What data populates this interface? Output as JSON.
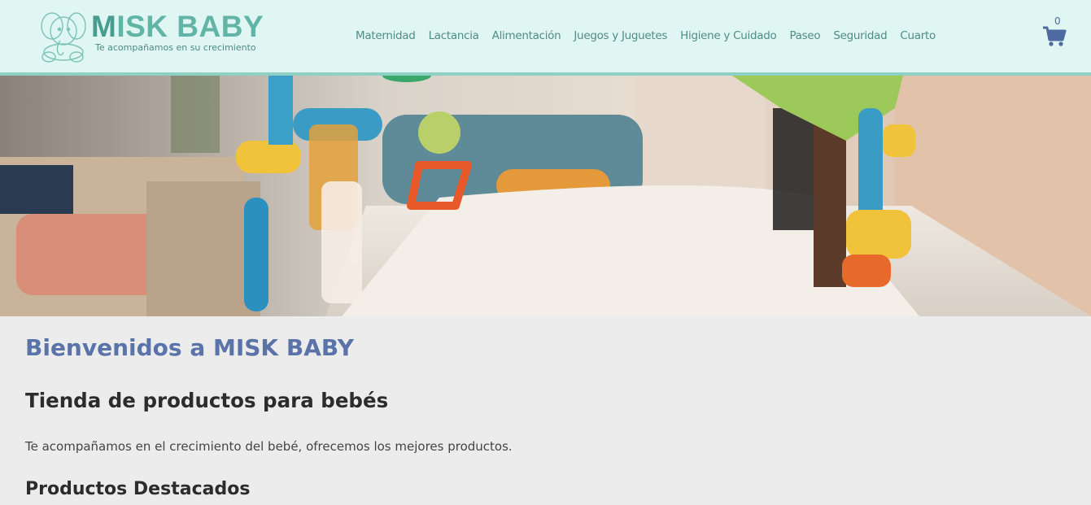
{
  "header": {
    "brand_part1": "M",
    "brand_part2": "ISK B",
    "brand_part3": "ABY",
    "tagline": "Te acompañamos en su crecimiento",
    "logo_icon": "elephant-icon",
    "nav": [
      {
        "label": "Maternidad"
      },
      {
        "label": "Lactancia"
      },
      {
        "label": "Alimentación"
      },
      {
        "label": "Juegos y Juguetes"
      },
      {
        "label": "Higiene y Cuidado"
      },
      {
        "label": "Paseo"
      },
      {
        "label": "Seguridad"
      },
      {
        "label": "Cuarto"
      }
    ],
    "cart": {
      "icon": "cart-icon",
      "count": "0"
    }
  },
  "colors": {
    "header_bg": "#dff6f2",
    "header_border": "#8fd0c4",
    "brand": "#62b5a6",
    "nav_text": "#4f8c85",
    "heading_blue": "#5a73a8",
    "page_bg": "#ececec"
  },
  "main": {
    "welcome": "Bienvenidos a MISK BABY",
    "subtitle": "Tienda de productos para bebés",
    "description": "Te acompañamos en el crecimiento del bebé, ofrecemos los mejores productos.",
    "featured_heading": "Productos Destacados"
  }
}
